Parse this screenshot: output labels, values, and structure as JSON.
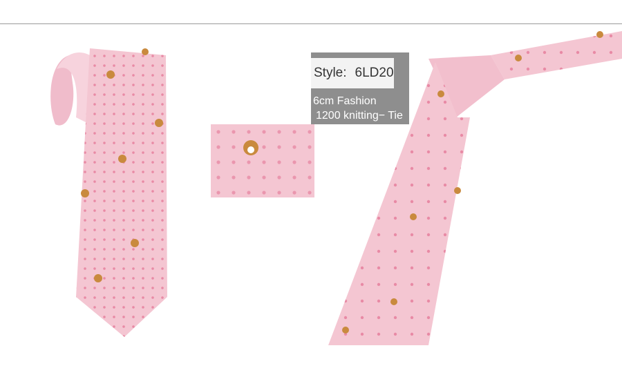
{
  "label": {
    "style_label": "Style:",
    "style_code": "6LD20",
    "desc_line1": "6cm Fashion",
    "desc_line2": "1200 knitting− Tie"
  },
  "colors": {
    "tie_pink": "#f4c6d2",
    "dot_pink": "#e88aa5",
    "corgi_tan": "#c98a3e",
    "label_gray": "#8e8e8e"
  },
  "images": {
    "tie_left": "pink-corgi-skinny-tie-rolled",
    "fabric_swatch": "fabric-closeup-corgi-and-dots",
    "tie_right": "pink-corgi-tie-knotted"
  }
}
